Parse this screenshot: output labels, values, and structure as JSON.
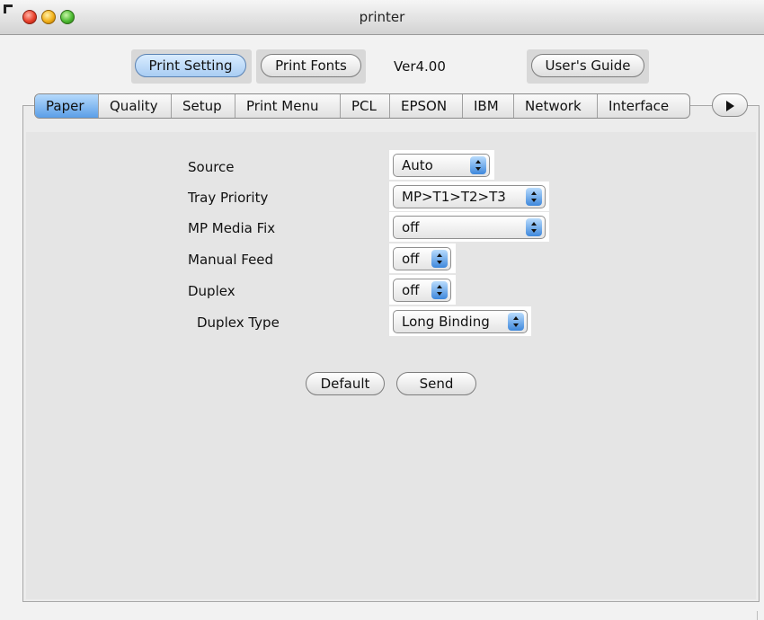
{
  "window": {
    "title": "printer"
  },
  "toolbar": {
    "print_setting": "Print Setting",
    "print_fonts": "Print Fonts",
    "version": "Ver4.00",
    "users_guide": "User's Guide"
  },
  "tabs": [
    "Paper",
    "Quality",
    "Setup",
    "Print Menu",
    "PCL",
    "EPSON",
    "IBM",
    "Network",
    "Interface"
  ],
  "active_tab": "Paper",
  "settings": [
    {
      "label": "Source",
      "value": "Auto"
    },
    {
      "label": "Tray Priority",
      "value": "MP>T1>T2>T3"
    },
    {
      "label": "MP Media Fix",
      "value": "off"
    },
    {
      "label": "Manual Feed",
      "value": "off"
    },
    {
      "label": "Duplex",
      "value": "off"
    },
    {
      "label": "Duplex Type",
      "value": "Long Binding"
    }
  ],
  "actions": {
    "default": "Default",
    "send": "Send"
  },
  "icons": {
    "close": "close-icon",
    "minimize": "minimize-icon",
    "zoom": "zoom-icon",
    "more_tabs": "play-arrow-icon",
    "popup": "up-down-arrows-icon"
  }
}
